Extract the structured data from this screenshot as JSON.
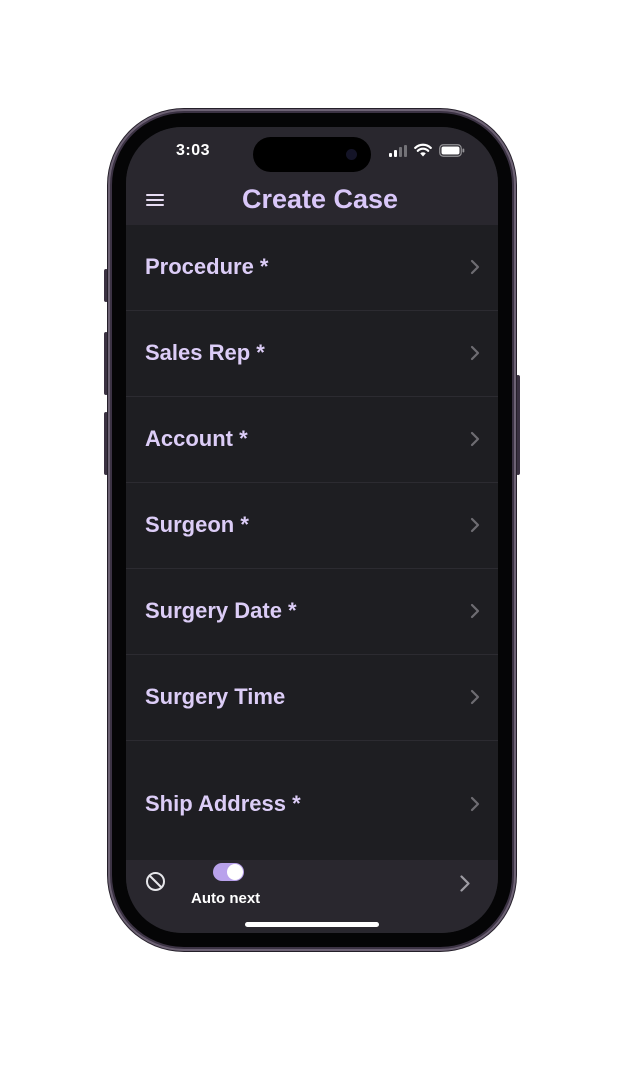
{
  "status_bar": {
    "time": "3:03",
    "icons": [
      "signal-icon",
      "wifi-icon",
      "battery-icon"
    ]
  },
  "header": {
    "title": "Create Case",
    "menu_icon": "menu-icon"
  },
  "form": {
    "rows": [
      {
        "label": "Procedure *",
        "icon": "chevron-right-icon"
      },
      {
        "label": "Sales Rep *",
        "icon": "chevron-right-icon"
      },
      {
        "label": "Account *",
        "icon": "chevron-right-icon"
      },
      {
        "label": "Surgeon *",
        "icon": "chevron-right-icon"
      },
      {
        "label": "Surgery Date *",
        "icon": "chevron-right-icon"
      },
      {
        "label": "Surgery Time",
        "icon": "chevron-right-icon"
      },
      {
        "label": "Ship Address *",
        "icon": "chevron-right-icon"
      }
    ]
  },
  "footer": {
    "cancel_icon": "cancel-icon",
    "auto_next": {
      "label": "Auto next",
      "enabled": true
    },
    "next_icon": "chevron-right-icon"
  },
  "colors": {
    "accent": "#d9c7f9",
    "label": "#dccdf7",
    "toggle_on": "#b9a2ec",
    "background": "#1e1e22",
    "bar": "#29272e",
    "chevron": "#6e6c72"
  }
}
